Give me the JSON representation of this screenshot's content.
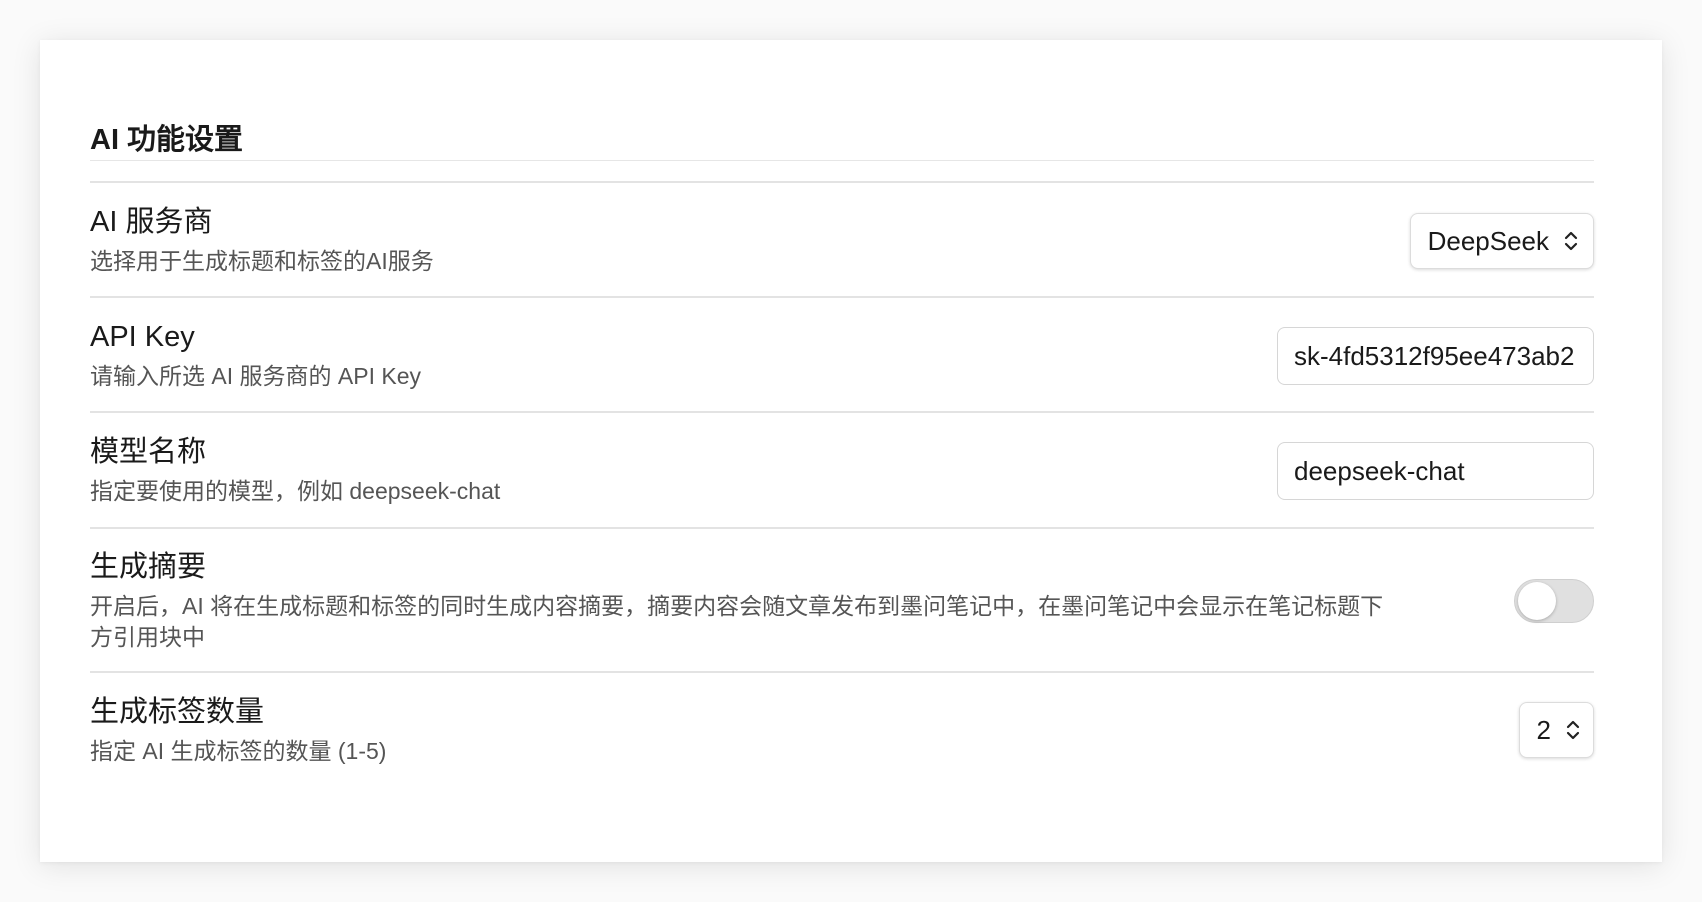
{
  "section": {
    "title": "AI 功能设置"
  },
  "settings": {
    "provider": {
      "label": "AI 服务商",
      "description": "选择用于生成标题和标签的AI服务",
      "value": "DeepSeek"
    },
    "api_key": {
      "label": "API Key",
      "description": "请输入所选 AI 服务商的 API Key",
      "value": "sk-4fd5312f95ee473ab2"
    },
    "model": {
      "label": "模型名称",
      "description": "指定要使用的模型，例如 deepseek-chat",
      "value": "deepseek-chat"
    },
    "summary": {
      "label": "生成摘要",
      "description": "开启后，AI 将在生成标题和标签的同时生成内容摘要，摘要内容会随文章发布到墨问笔记中，在墨问笔记中会显示在笔记标题下方引用块中",
      "enabled": false
    },
    "tag_count": {
      "label": "生成标签数量",
      "description": "指定 AI 生成标签的数量 (1-5)",
      "value": "2"
    }
  },
  "icons": {
    "select_arrow": "chevron-up-down-icon"
  },
  "colors": {
    "divider": "#e3e3e3",
    "toggle_off": "#e0e0e0",
    "text_secondary": "#555555"
  }
}
